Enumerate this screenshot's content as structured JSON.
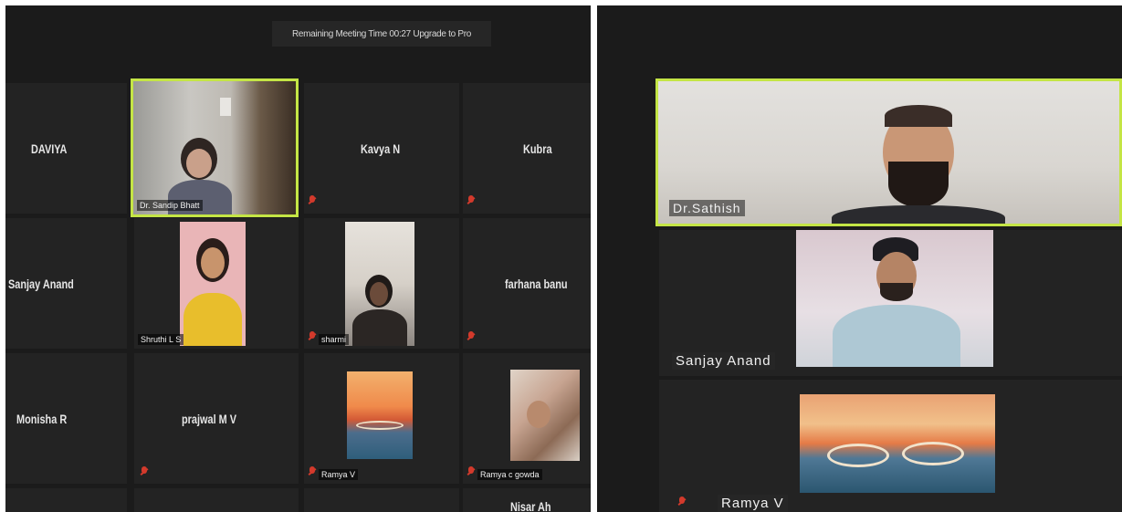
{
  "left": {
    "banner": "Remaining Meeting Time 00:27 Upgrade to Pro",
    "tiles": {
      "daviya": {
        "name": "DAVIYA"
      },
      "host": {
        "label": "Dr. Sandip Bhatt"
      },
      "kavya": {
        "name": "Kavya N"
      },
      "kubra": {
        "name": "Kubra"
      },
      "sanjay": {
        "name": "Sanjay Anand"
      },
      "shruthi": {
        "label": "Shruthi L S"
      },
      "sharmi": {
        "label": "sharmi"
      },
      "farhana": {
        "name": "farhana banu"
      },
      "monisha": {
        "name": "Monisha R"
      },
      "prajwal": {
        "name": "prajwal M V"
      },
      "ramya": {
        "label": "Ramya V"
      },
      "ramya_c": {
        "label": "Ramya c gowda"
      },
      "partial": {
        "name": "Nisar Ah"
      }
    }
  },
  "right": {
    "tiles": {
      "speaker": {
        "label": "Dr.Sathish"
      },
      "sanjay": {
        "label": "Sanjay Anand"
      },
      "ramya": {
        "label": "Ramya V"
      }
    }
  },
  "colors": {
    "active_border": "#c4e545",
    "muted_mic": "#d33a2c",
    "background": "#1b1b1b"
  }
}
